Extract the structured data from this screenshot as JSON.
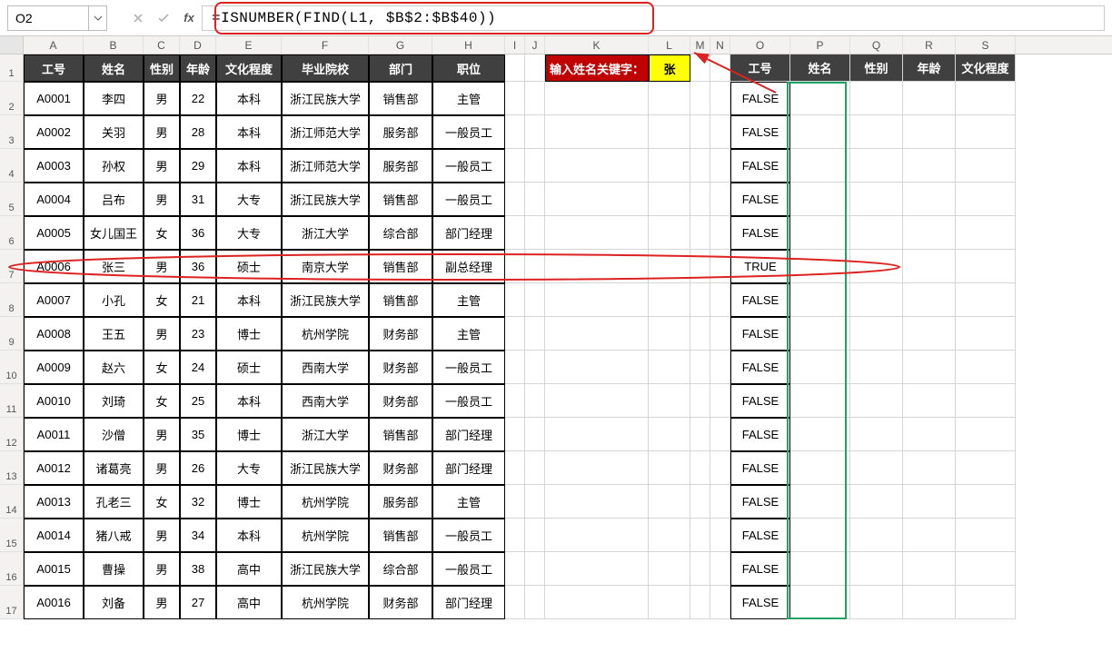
{
  "name_box": "O2",
  "formula": "=ISNUMBER(FIND(L1, $B$2:$B$40))",
  "columns": [
    "A",
    "B",
    "C",
    "D",
    "E",
    "F",
    "G",
    "H",
    "I",
    "J",
    "K",
    "L",
    "M",
    "N",
    "O",
    "P",
    "Q",
    "R",
    "S"
  ],
  "row_numbers": [
    "1",
    "2",
    "3",
    "4",
    "5",
    "6",
    "7",
    "8",
    "9",
    "10",
    "11",
    "12",
    "13",
    "14",
    "15",
    "16",
    "17"
  ],
  "main_headers": [
    "工号",
    "姓名",
    "性别",
    "年龄",
    "文化程度",
    "毕业院校",
    "部门",
    "职位"
  ],
  "search_label": "输入姓名关键字：",
  "search_value": "张",
  "result_headers": [
    "工号",
    "姓名",
    "性别",
    "年龄",
    "文化程度"
  ],
  "data_rows": [
    {
      "id": "A0001",
      "name": "李四",
      "sex": "男",
      "age": "22",
      "edu": "本科",
      "school": "浙江民族大学",
      "dept": "销售部",
      "pos": "主管",
      "o": "FALSE"
    },
    {
      "id": "A0002",
      "name": "关羽",
      "sex": "男",
      "age": "28",
      "edu": "本科",
      "school": "浙江师范大学",
      "dept": "服务部",
      "pos": "一般员工",
      "o": "FALSE"
    },
    {
      "id": "A0003",
      "name": "孙权",
      "sex": "男",
      "age": "29",
      "edu": "本科",
      "school": "浙江师范大学",
      "dept": "服务部",
      "pos": "一般员工",
      "o": "FALSE"
    },
    {
      "id": "A0004",
      "name": "吕布",
      "sex": "男",
      "age": "31",
      "edu": "大专",
      "school": "浙江民族大学",
      "dept": "销售部",
      "pos": "一般员工",
      "o": "FALSE"
    },
    {
      "id": "A0005",
      "name": "女儿国王",
      "sex": "女",
      "age": "36",
      "edu": "大专",
      "school": "浙江大学",
      "dept": "综合部",
      "pos": "部门经理",
      "o": "FALSE"
    },
    {
      "id": "A0006",
      "name": "张三",
      "sex": "男",
      "age": "36",
      "edu": "硕士",
      "school": "南京大学",
      "dept": "销售部",
      "pos": "副总经理",
      "o": "TRUE"
    },
    {
      "id": "A0007",
      "name": "小孔",
      "sex": "女",
      "age": "21",
      "edu": "本科",
      "school": "浙江民族大学",
      "dept": "销售部",
      "pos": "主管",
      "o": "FALSE"
    },
    {
      "id": "A0008",
      "name": "王五",
      "sex": "男",
      "age": "23",
      "edu": "博士",
      "school": "杭州学院",
      "dept": "财务部",
      "pos": "主管",
      "o": "FALSE"
    },
    {
      "id": "A0009",
      "name": "赵六",
      "sex": "女",
      "age": "24",
      "edu": "硕士",
      "school": "西南大学",
      "dept": "财务部",
      "pos": "一般员工",
      "o": "FALSE"
    },
    {
      "id": "A0010",
      "name": "刘琦",
      "sex": "女",
      "age": "25",
      "edu": "本科",
      "school": "西南大学",
      "dept": "财务部",
      "pos": "一般员工",
      "o": "FALSE"
    },
    {
      "id": "A0011",
      "name": "沙僧",
      "sex": "男",
      "age": "35",
      "edu": "博士",
      "school": "浙江大学",
      "dept": "销售部",
      "pos": "部门经理",
      "o": "FALSE"
    },
    {
      "id": "A0012",
      "name": "诸葛亮",
      "sex": "男",
      "age": "26",
      "edu": "大专",
      "school": "浙江民族大学",
      "dept": "财务部",
      "pos": "部门经理",
      "o": "FALSE"
    },
    {
      "id": "A0013",
      "name": "孔老三",
      "sex": "女",
      "age": "32",
      "edu": "博士",
      "school": "杭州学院",
      "dept": "服务部",
      "pos": "主管",
      "o": "FALSE"
    },
    {
      "id": "A0014",
      "name": "猪八戒",
      "sex": "男",
      "age": "34",
      "edu": "本科",
      "school": "杭州学院",
      "dept": "销售部",
      "pos": "一般员工",
      "o": "FALSE"
    },
    {
      "id": "A0015",
      "name": "曹操",
      "sex": "男",
      "age": "38",
      "edu": "高中",
      "school": "浙江民族大学",
      "dept": "综合部",
      "pos": "一般员工",
      "o": "FALSE"
    },
    {
      "id": "A0016",
      "name": "刘备",
      "sex": "男",
      "age": "27",
      "edu": "高中",
      "school": "杭州学院",
      "dept": "财务部",
      "pos": "部门经理",
      "o": "FALSE"
    }
  ]
}
